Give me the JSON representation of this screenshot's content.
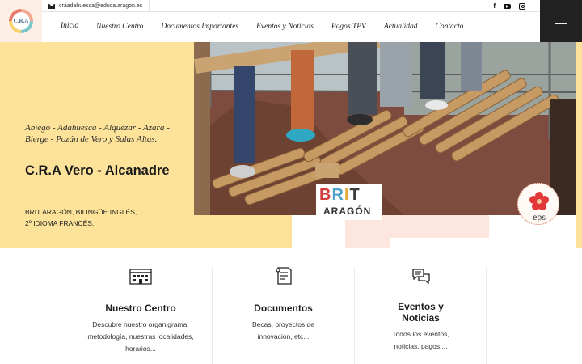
{
  "header": {
    "logo_text": "C.R.A",
    "email": "craadahuesca@educa.aragon.es",
    "social_icons": [
      "facebook-icon",
      "youtube-icon",
      "instagram-icon"
    ],
    "menu_icon": "hamburger-menu-icon"
  },
  "nav": {
    "items": [
      {
        "label": "Inicio",
        "active": true
      },
      {
        "label": "Nuestro Centro",
        "active": false
      },
      {
        "label": "Documentos Importantes",
        "active": false
      },
      {
        "label": "Eventos y Noticias",
        "active": false
      },
      {
        "label": "Pagos TPV",
        "active": false
      },
      {
        "label": "Actualidad",
        "active": false
      },
      {
        "label": "Contacto",
        "active": false
      }
    ]
  },
  "hero": {
    "villages_line1": "Abiego - Adahuesca - Alquézar - Azara -",
    "villages_line2": "Bierge - Pozán de Vero y Salas Altas.",
    "school_name": "C.R.A Vero - Alcanadre",
    "langs_line1": "BRIT ARAGÓN, BILINGÜE INGLÉS,",
    "langs_line2": "2º IDIOMA FRANCÉS..",
    "brit_badge": {
      "word": "BRIT",
      "region": "ARAGÓN"
    },
    "eps_badge": {
      "label": "eps"
    },
    "colors": {
      "accent_yellow": "#fde29a",
      "accent_peach": "#fde6dd"
    }
  },
  "features": [
    {
      "icon": "building-icon",
      "title_line1": "Nuestro Centro",
      "title_line2": "",
      "desc": [
        "Descubre nuestro organigrama,",
        "metodología, nuestras localidades,",
        "horarios..."
      ]
    },
    {
      "icon": "document-list-icon",
      "title_line1": "Documentos",
      "title_line2": "",
      "desc": [
        "Becas, proyectos de",
        "innovación, etc..."
      ]
    },
    {
      "icon": "chat-bubbles-icon",
      "title_line1": "Eventos y",
      "title_line2": "Noticias",
      "desc": [
        "Todos los eventos,",
        "noticias, pagos ..."
      ]
    }
  ]
}
